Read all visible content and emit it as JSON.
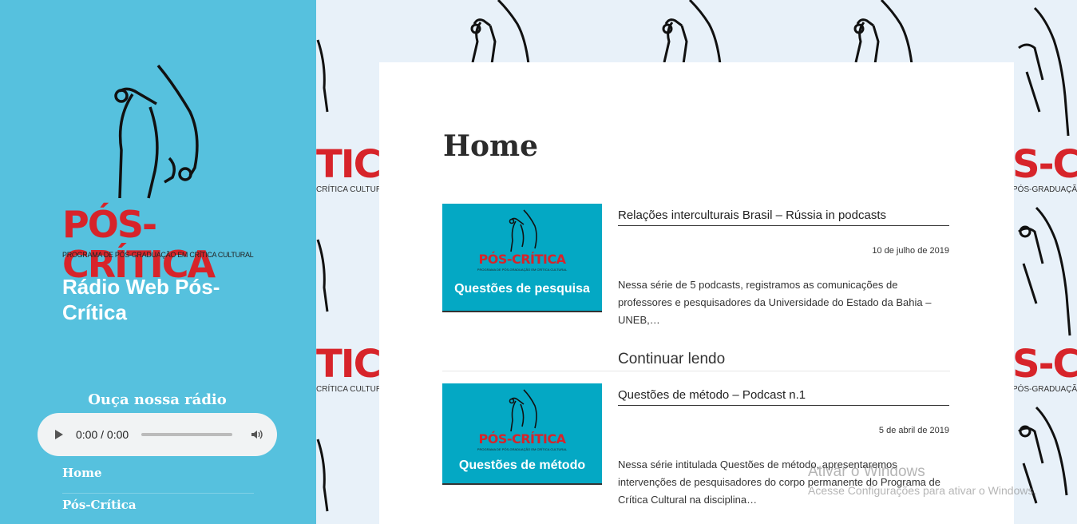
{
  "brand": {
    "logo_word": "PÓS-CRÍTICA",
    "logo_sub": "PROGRAMA DE PÓS-GRADUAÇÃO EM CRÍTICA CULTURAL",
    "red": "#d7242a",
    "sidebar_bg": "#56c1de",
    "thumb_bg": "#04a8c4"
  },
  "sidebar": {
    "site_title": "Rádio Web Pós-Crítica",
    "widget_title": "Ouça nossa rádio",
    "player": {
      "time": "0:00 / 0:00"
    },
    "nav": [
      {
        "label": "Home"
      },
      {
        "label": "Pós-Crítica"
      }
    ]
  },
  "background": {
    "word_partial": "TICA",
    "sub_partial": "CRÍTICA CULTURAL",
    "word_partial_right": "S-CRÍ",
    "sub_partial_right": "PÓS-GRADUAÇÃO E"
  },
  "main": {
    "page_title": "Home",
    "posts": [
      {
        "thumb_caption": "Questões de pesquisa",
        "title": "Relações interculturais Brasil – Rússia in podcasts",
        "date": "10 de julho de 2019",
        "excerpt": "Nessa série de 5 podcasts, registramos as comunicações de professores e pesquisadores da Universidade do Estado da Bahia – UNEB,…",
        "read_more": "Continuar lendo"
      },
      {
        "thumb_caption": "Questões de método",
        "title": "Questões de método – Podcast n.1",
        "date": "5 de abril de 2019",
        "excerpt": "Nessa série intitulada Questões de método, apresentaremos intervenções de pesquisadores do corpo permanente do Programa de Crítica Cultural na disciplina…"
      }
    ]
  },
  "watermark": {
    "line1": "Ativar o Windows",
    "line2": "Acesse Configurações para ativar o Windows."
  }
}
